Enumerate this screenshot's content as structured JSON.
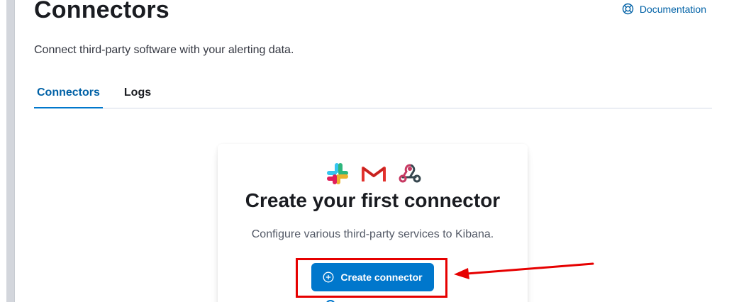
{
  "header": {
    "title": "Connectors",
    "documentation_link": "Documentation",
    "subtitle": "Connect third-party software with your alerting data."
  },
  "tabs": [
    {
      "label": "Connectors",
      "active": true
    },
    {
      "label": "Logs",
      "active": false
    }
  ],
  "empty_state": {
    "logos": [
      "slack-icon",
      "gmail-icon",
      "webhook-icon"
    ],
    "title": "Create your first connector",
    "description": "Configure various third-party services to Kibana.",
    "button_label": "Create connector",
    "button_icon": "plus-circle-icon"
  },
  "annotation": {
    "highlight_color": "#e60000",
    "target": "Create connector"
  },
  "colors": {
    "accent": "#0077cc",
    "link": "#0061a6",
    "text": "#1a1c21"
  }
}
